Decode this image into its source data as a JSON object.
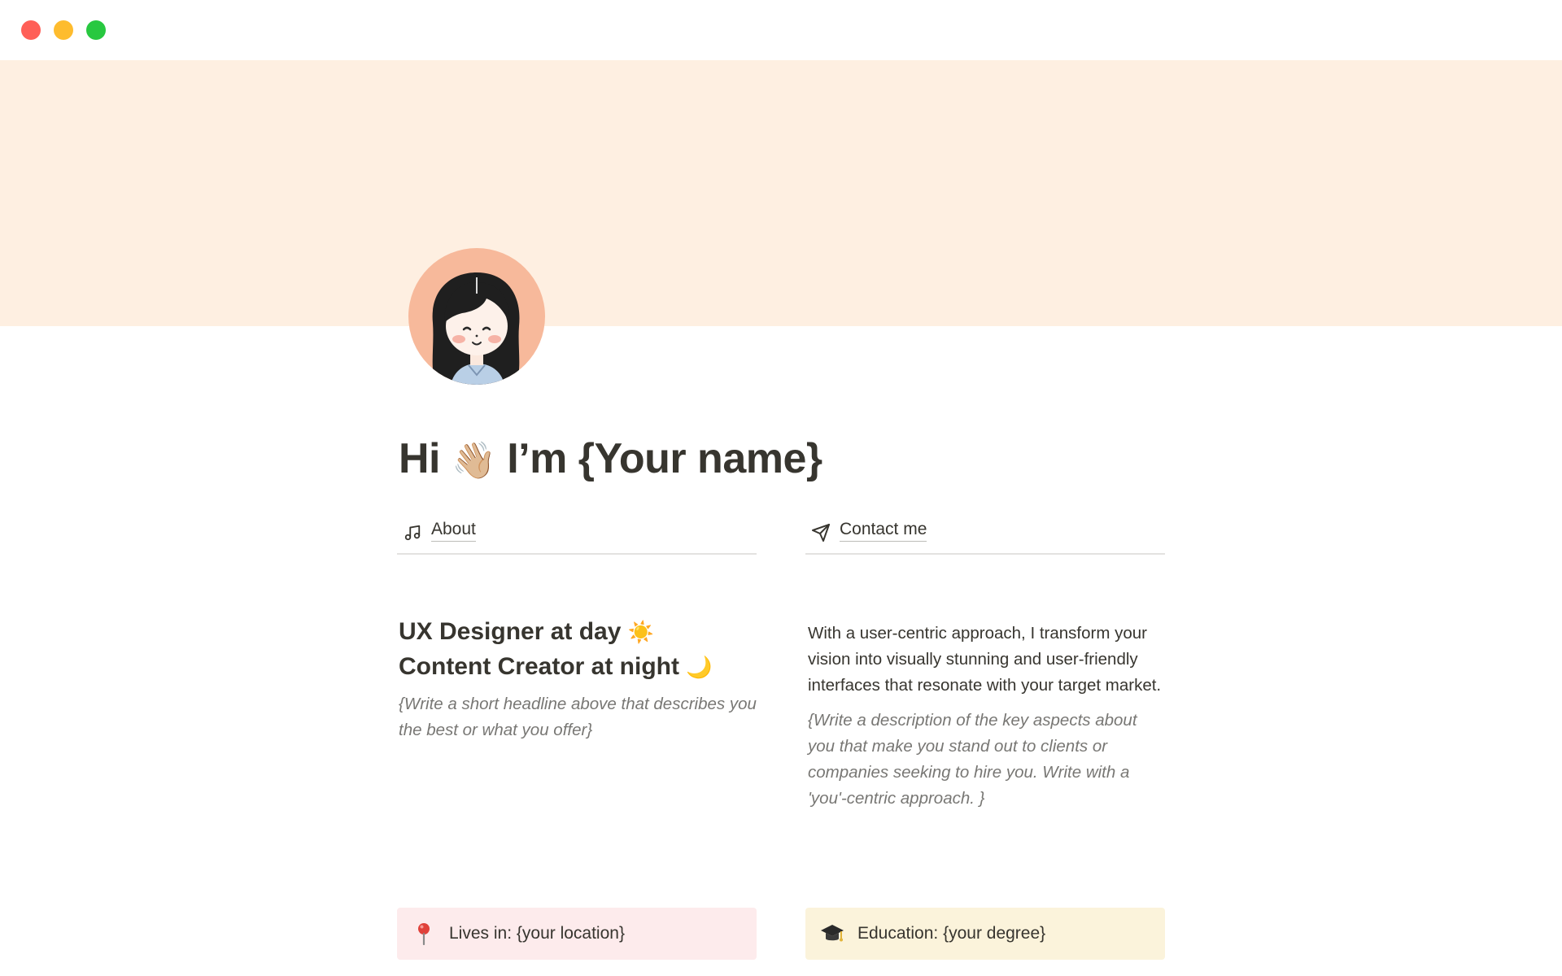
{
  "window": {
    "controls": [
      "close",
      "minimize",
      "maximize"
    ]
  },
  "cover": {
    "color": "#feefe1"
  },
  "page": {
    "title_prefix": "Hi",
    "title_emoji": "👋🏼",
    "title_suffix": "I’m {Your name}"
  },
  "tabs": [
    {
      "label": "About",
      "icon": "music-note-icon"
    },
    {
      "label": "Contact me",
      "icon": "paper-plane-icon"
    }
  ],
  "about": {
    "headline_line1": "UX Designer at day",
    "headline_line1_emoji": "☀️",
    "headline_line2": "Content Creator at night",
    "headline_line2_emoji": "🌙",
    "hint": "{Write a short headline above that describes you the best or what you offer}"
  },
  "description": {
    "text": "With a user-centric approach, I transform your vision into visually stunning and user-friendly interfaces that resonate with your target market.",
    "hint": "{Write a description of the key aspects about you that make you stand out to clients or companies seeking to hire you. Write with a 'you'-centric approach. }"
  },
  "callouts": [
    {
      "text": "Lives in: {your location}",
      "icon": "round-pushpin-icon",
      "color": "#fdebec"
    },
    {
      "text": "Education: {your degree}",
      "icon": "graduation-cap-icon",
      "color": "#fbf3db"
    }
  ]
}
